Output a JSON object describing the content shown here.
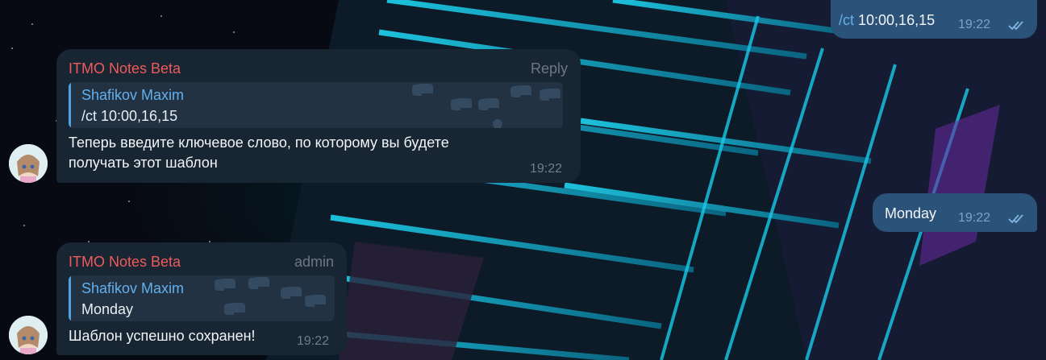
{
  "colors": {
    "incoming_bubble": "#182533",
    "outgoing_bubble": "#2b5278",
    "sender_name": "#ef5b5b",
    "reply_name": "#62b0ee",
    "command_link": "#62b0ee"
  },
  "messages": [
    {
      "direction": "outgoing",
      "command": "/ct",
      "args": " 10:00,16,15",
      "time": "19:22",
      "status_icon": "double-check-icon"
    },
    {
      "direction": "incoming",
      "sender": "ITMO Notes Beta",
      "tag": "Reply",
      "reply": {
        "name": "Shafikov Maxim",
        "text": "/ct 10:00,16,15"
      },
      "text_line1": "Теперь введите ключевое слово, по которому вы будете",
      "text_line2": "получать этот шаблон",
      "time": "19:22",
      "avatar_icon": "bot-avatar"
    },
    {
      "direction": "outgoing",
      "text": "Monday",
      "time": "19:22",
      "status_icon": "double-check-icon"
    },
    {
      "direction": "incoming",
      "sender": "ITMO Notes Beta",
      "tag": "admin",
      "reply": {
        "name": "Shafikov Maxim",
        "text": "Monday"
      },
      "text": "Шаблон успешно сохранен!",
      "time": "19:22",
      "avatar_icon": "bot-avatar"
    }
  ]
}
